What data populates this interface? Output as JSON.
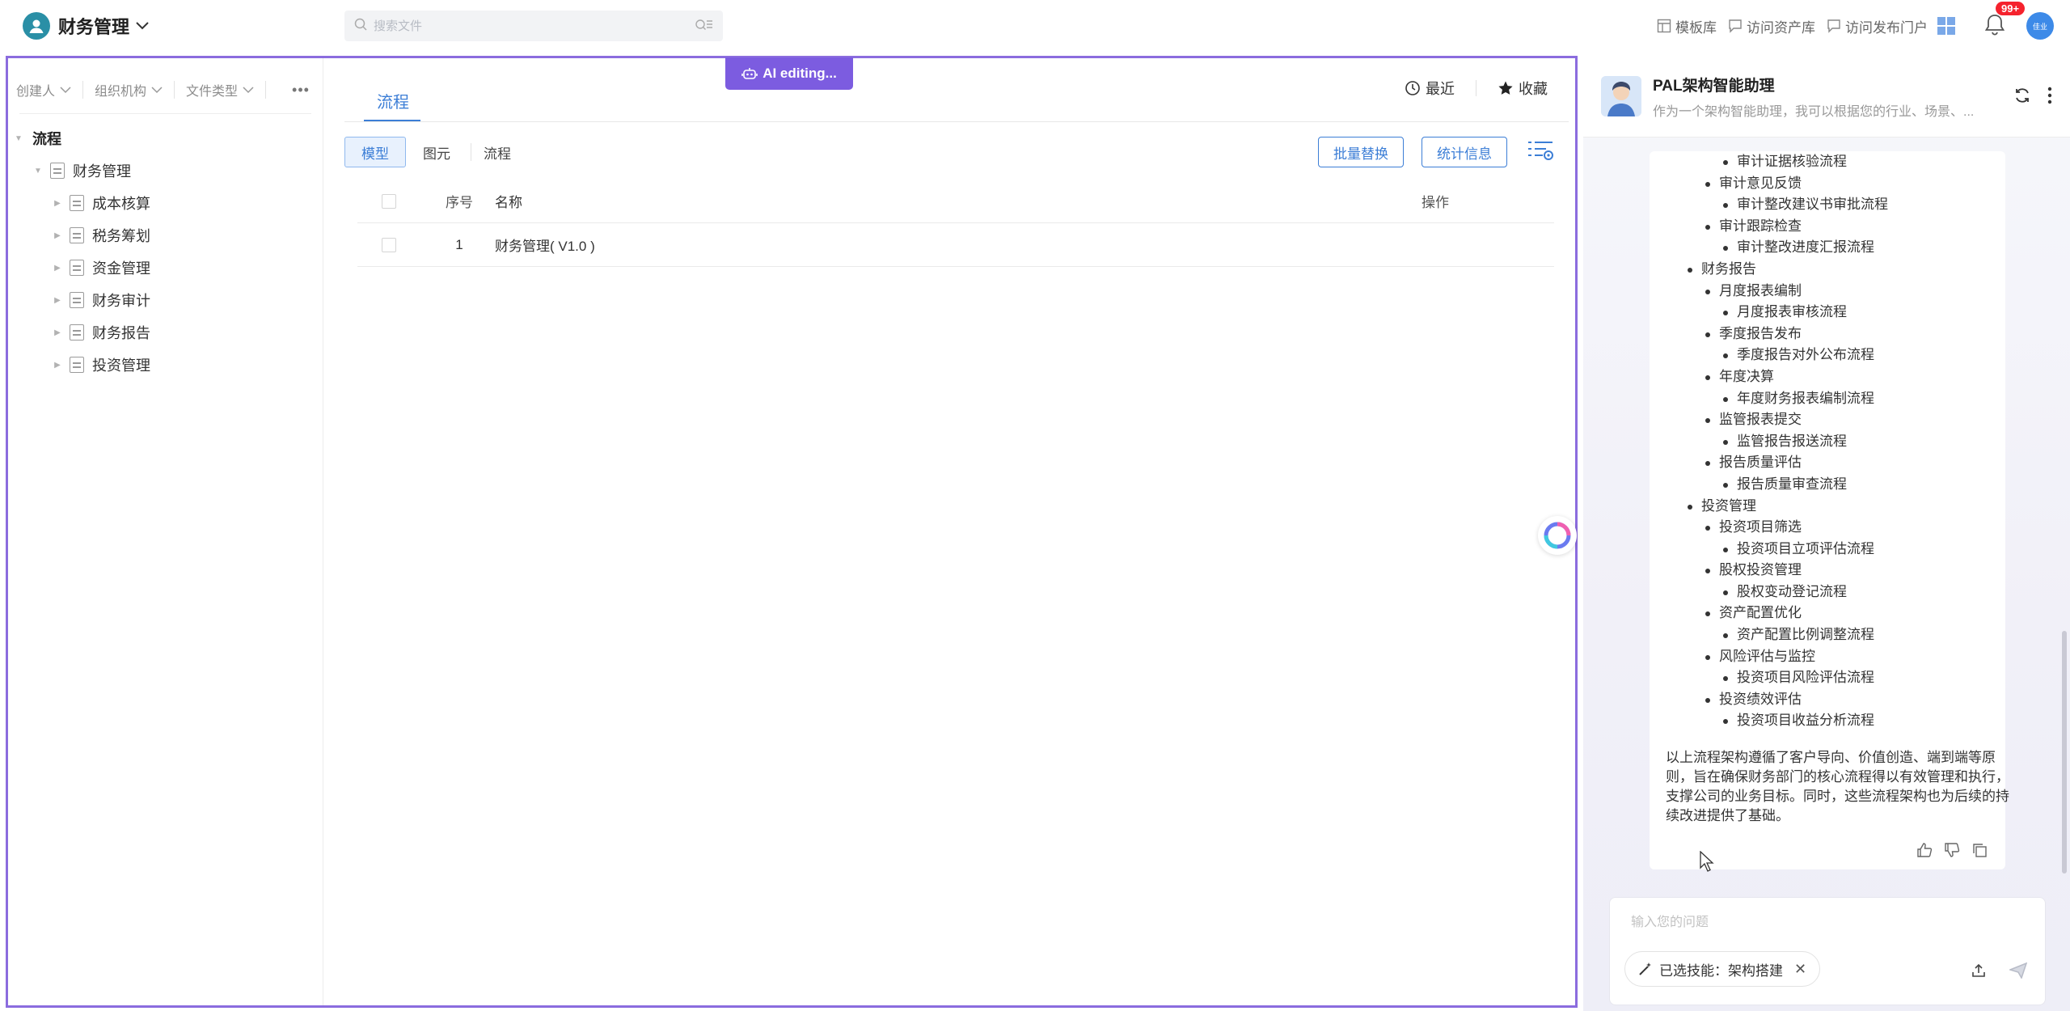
{
  "topbar": {
    "app_title": "财务管理",
    "search_placeholder": "搜索文件",
    "links": [
      "模板库",
      "访问资产库",
      "访问发布门户"
    ],
    "notification_count": "99+",
    "user_avatar_text": "佳业"
  },
  "ai_badge": "AI editing...",
  "left": {
    "filters": [
      "创建人",
      "组织机构",
      "文件类型"
    ],
    "tree_root": "流程",
    "tree_parent": "财务管理",
    "tree_children": [
      "成本核算",
      "税务筹划",
      "资金管理",
      "财务审计",
      "财务报告",
      "投资管理"
    ]
  },
  "center": {
    "tab": "流程",
    "recent": "最近",
    "favorite": "收藏",
    "segments": [
      "模型",
      "图元",
      "流程"
    ],
    "btn_batch": "批量替换",
    "btn_stats": "统计信息",
    "table": {
      "headers": {
        "index": "序号",
        "name": "名称",
        "op": "操作"
      },
      "rows": [
        {
          "index": "1",
          "name": "财务管理( V1.0 )"
        }
      ]
    }
  },
  "assistant": {
    "title": "PAL架构智能助理",
    "subtitle": "作为一个架构智能助理，我可以根据您的行业、场景、...",
    "items": [
      {
        "level": 3,
        "text": "审计证据核验流程"
      },
      {
        "level": 2,
        "text": "审计意见反馈"
      },
      {
        "level": 3,
        "text": "审计整改建议书审批流程"
      },
      {
        "level": 2,
        "text": "审计跟踪检查"
      },
      {
        "level": 3,
        "text": "审计整改进度汇报流程"
      },
      {
        "level": 1,
        "text": "财务报告"
      },
      {
        "level": 2,
        "text": "月度报表编制"
      },
      {
        "level": 3,
        "text": "月度报表审核流程"
      },
      {
        "level": 2,
        "text": "季度报告发布"
      },
      {
        "level": 3,
        "text": "季度报告对外公布流程"
      },
      {
        "level": 2,
        "text": "年度决算"
      },
      {
        "level": 3,
        "text": "年度财务报表编制流程"
      },
      {
        "level": 2,
        "text": "监管报表提交"
      },
      {
        "level": 3,
        "text": "监管报告报送流程"
      },
      {
        "level": 2,
        "text": "报告质量评估"
      },
      {
        "level": 3,
        "text": "报告质量审查流程"
      },
      {
        "level": 1,
        "text": "投资管理"
      },
      {
        "level": 2,
        "text": "投资项目筛选"
      },
      {
        "level": 3,
        "text": "投资项目立项评估流程"
      },
      {
        "level": 2,
        "text": "股权投资管理"
      },
      {
        "level": 3,
        "text": "股权变动登记流程"
      },
      {
        "level": 2,
        "text": "资产配置优化"
      },
      {
        "level": 3,
        "text": "资产配置比例调整流程"
      },
      {
        "level": 2,
        "text": "风险评估与监控"
      },
      {
        "level": 3,
        "text": "投资项目风险评估流程"
      },
      {
        "level": 2,
        "text": "投资绩效评估"
      },
      {
        "level": 3,
        "text": "投资项目收益分析流程"
      }
    ],
    "summary": "以上流程架构遵循了客户导向、价值创造、端到端等原则，旨在确保财务部门的核心流程得以有效管理和执行，支撑公司的业务目标。同时，这些流程架构也为后续的持续改进提供了基础。",
    "input_placeholder": "输入您的问题",
    "skill_chip": "已选技能：架构搭建"
  },
  "colors": {
    "accent": "#3c7ed6",
    "frame": "#8b6cde",
    "ai_badge": "#7c5ce0",
    "badge": "#f5222d"
  }
}
